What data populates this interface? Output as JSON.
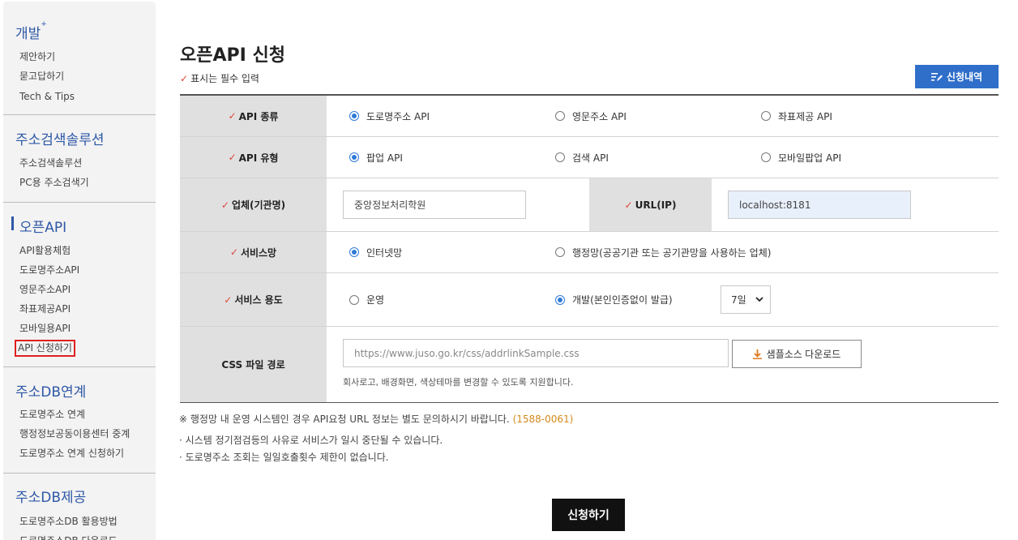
{
  "sidebar": {
    "groups": [
      {
        "title": "개발",
        "title_sup": "+",
        "items": [
          "제안하기",
          "묻고답하기",
          "Tech & Tips"
        ]
      },
      {
        "title": "주소검색솔루션",
        "items": [
          "주소검색솔루션",
          "PC용 주소검색기"
        ]
      },
      {
        "title": "오픈API",
        "items": [
          "API활용체험",
          "도로명주소API",
          "영문주소API",
          "좌표제공API",
          "모바일용API",
          "API 신청하기"
        ]
      },
      {
        "title": "주소DB연계",
        "items": [
          "도로명주소 연계",
          "행정정보공동이용센터 중계",
          "도로명주소 연계 신청하기"
        ]
      },
      {
        "title": "주소DB제공",
        "items": [
          "도로명주소DB 활용방법",
          "도로명주소DB 다운로드"
        ]
      }
    ]
  },
  "page": {
    "title": "오픈API 신청",
    "required_mark": "✓",
    "required_note": "표시는 필수 입력",
    "history_button": "신청내역"
  },
  "form": {
    "api_kind": {
      "label": "API 종류",
      "options": [
        "도로명주소 API",
        "영문주소 API",
        "좌표제공 API"
      ],
      "selected": 0
    },
    "api_type": {
      "label": "API 유형",
      "options": [
        "팝업 API",
        "검색 API",
        "모바일팝업 API"
      ],
      "selected": 0
    },
    "company": {
      "label": "업체(기관명)",
      "value": "중앙정보처리학원"
    },
    "url": {
      "label": "URL(IP)",
      "value": "localhost:8181"
    },
    "network": {
      "label": "서비스망",
      "options": [
        "인터넷망",
        "행정망(공공기관 또는 공기관망을 사용하는 업체)"
      ],
      "selected": 0
    },
    "usage": {
      "label": "서비스 용도",
      "options": [
        "운영",
        "개발(본인인증없이 발급)"
      ],
      "selected": 1,
      "period": "7일"
    },
    "css": {
      "label": "CSS 파일 경로",
      "placeholder": "https://www.juso.go.kr/css/addrlinkSample.css",
      "download_button": "샘플소스 다운로드",
      "help": "회사로고, 배경화면, 색상테마를 변경할 수 있도록 지원합니다."
    }
  },
  "notices": {
    "network_note": "※ 행정망 내 운영 시스템인 경우 API요청 URL 정보는 별도 문의하시기 바랍니다.",
    "tel": "(1588-0061)",
    "line1": "· 시스템 정기점검등의 사유로 서비스가 일시 중단될 수 있습니다.",
    "line2": "· 도로명주소 조회는 일일호출횟수 제한이 없습니다."
  },
  "submit_button": "신청하기",
  "colors": {
    "accent": "#2f6fca",
    "required": "#e0443c",
    "sidebar_title": "#2d57a6"
  }
}
